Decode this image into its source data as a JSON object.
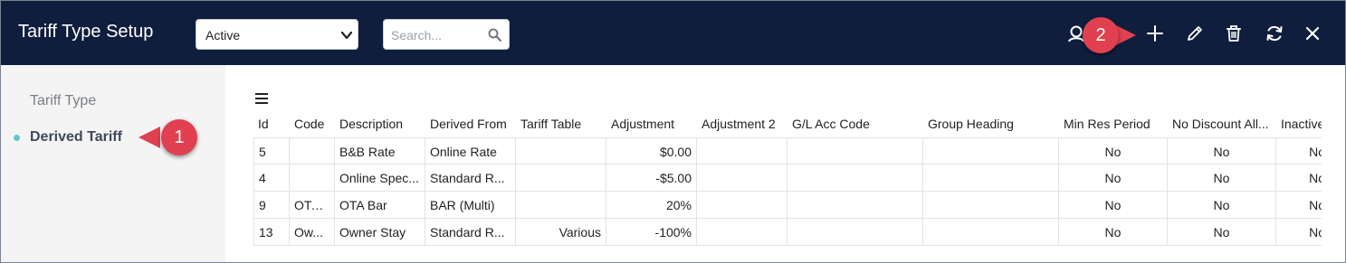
{
  "header": {
    "title": "Tariff Type Setup",
    "status_select": {
      "value": "Active"
    },
    "search": {
      "placeholder": "Search..."
    },
    "icons": [
      "person-help-icon",
      "plus-icon",
      "pencil-icon",
      "trash-icon",
      "refresh-icon",
      "close-icon"
    ]
  },
  "callouts": {
    "one": "1",
    "two": "2"
  },
  "sidebar": {
    "items": [
      {
        "label": "Tariff Type"
      },
      {
        "label": "Derived Tariff"
      }
    ]
  },
  "table": {
    "columns": [
      "Id",
      "Code",
      "Description",
      "Derived From",
      "Tariff Table",
      "Adjustment",
      "Adjustment 2",
      "G/L Acc Code",
      "Group Heading",
      "Min Res Period",
      "No Discount All...",
      "Inactive"
    ],
    "rows": [
      [
        "5",
        "",
        "B&B Rate",
        "Online Rate",
        "",
        "$0.00",
        "",
        "",
        "",
        "No",
        "No",
        "No"
      ],
      [
        "4",
        "",
        "Online Spec...",
        "Standard R...",
        "",
        "-$5.00",
        "",
        "",
        "",
        "No",
        "No",
        "No"
      ],
      [
        "9",
        "OTA...",
        "OTA Bar",
        "BAR (Multi)",
        "",
        "20%",
        "",
        "",
        "",
        "No",
        "No",
        "No"
      ],
      [
        "13",
        "Ow...",
        "Owner Stay",
        "Standard R...",
        "Various",
        "-100%",
        "",
        "",
        "",
        "No",
        "No",
        "No"
      ]
    ]
  },
  "colors": {
    "header_bg": "#0f1e3d",
    "callout": "#e0404f",
    "active_dot": "#5fc7cf"
  }
}
